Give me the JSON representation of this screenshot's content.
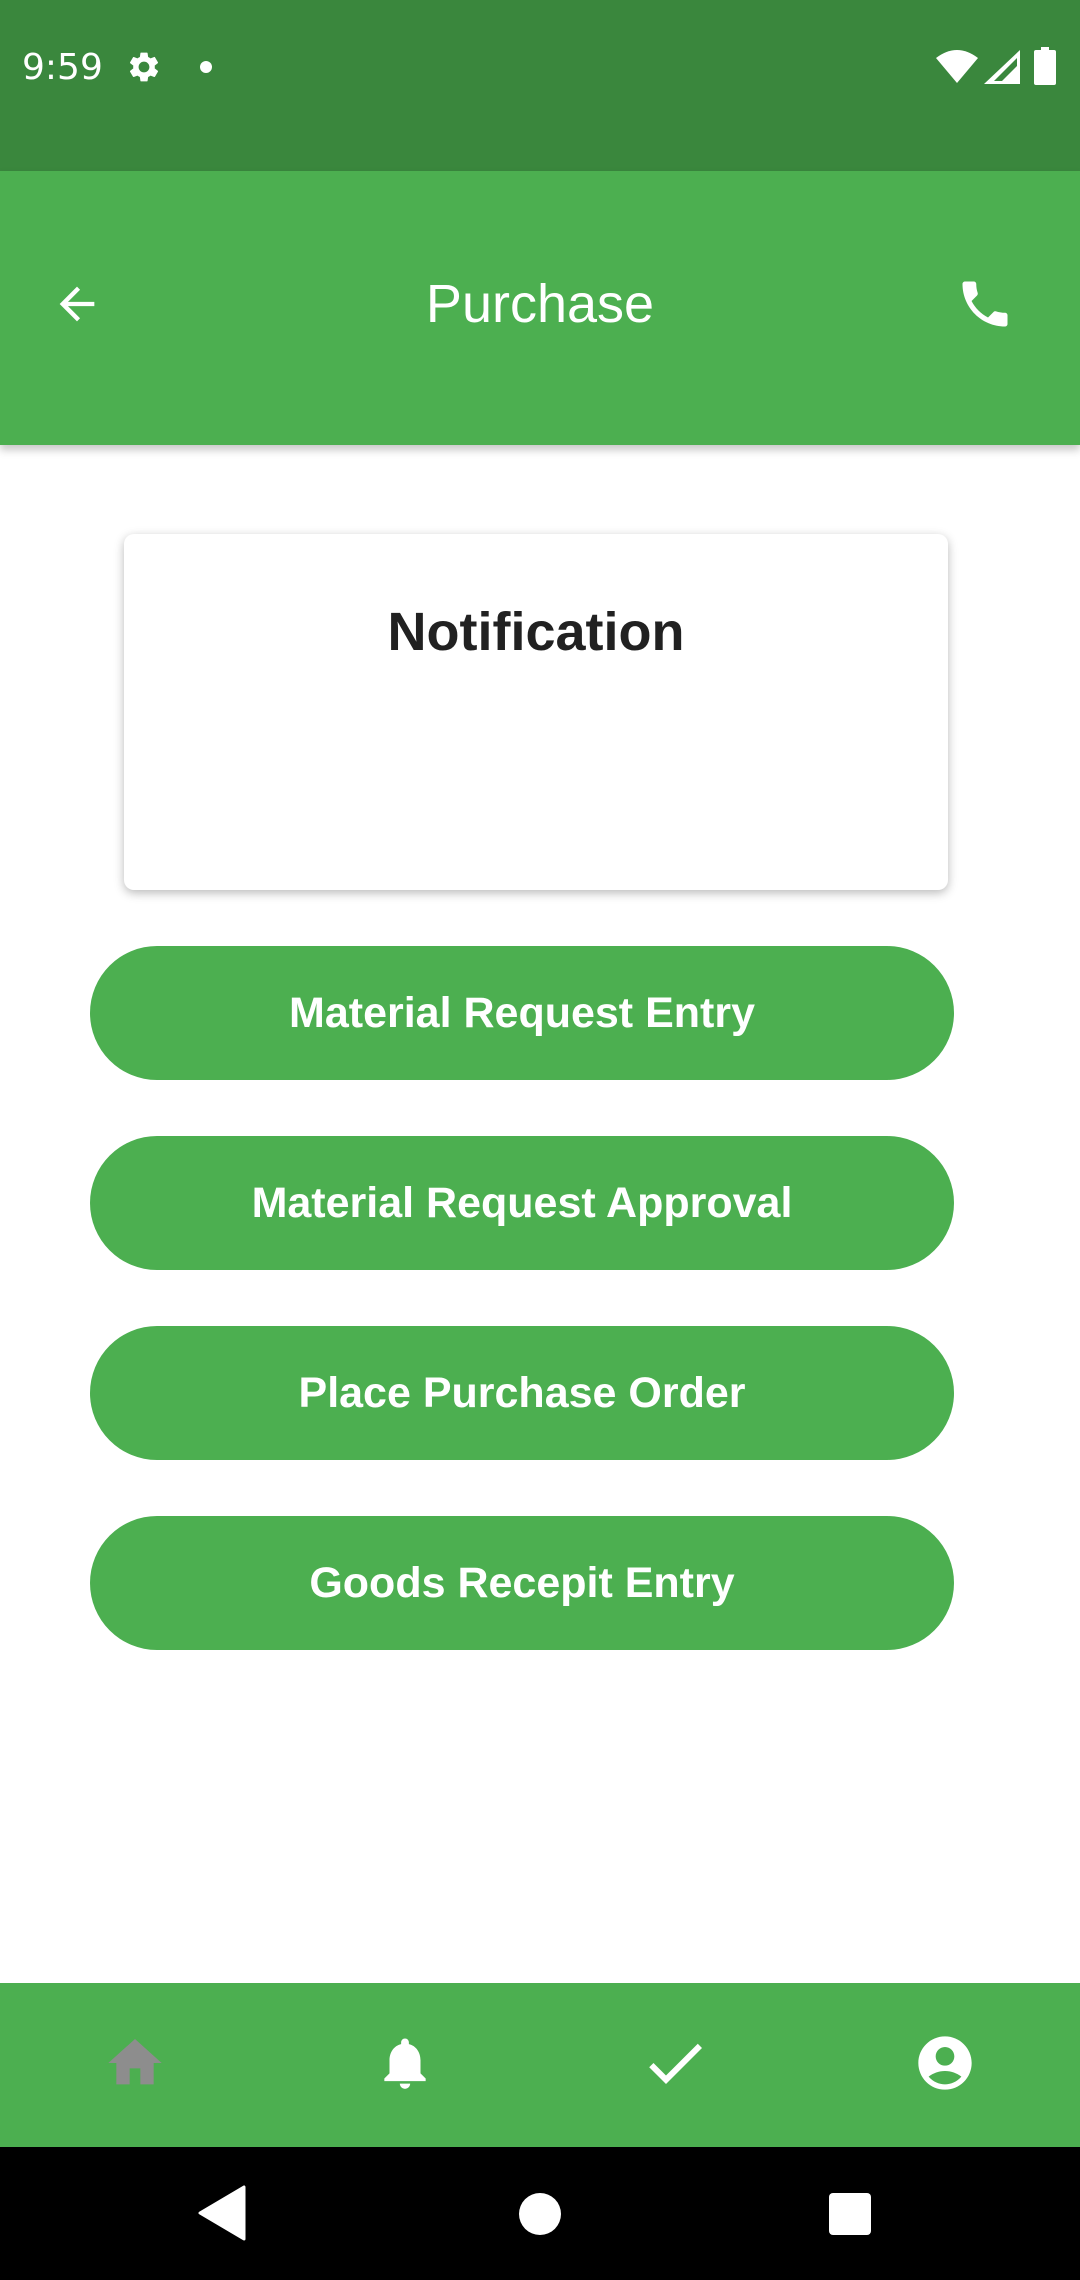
{
  "status_bar": {
    "time": "9:59",
    "icons": [
      "gear-icon",
      "dot-icon",
      "wifi-icon",
      "signal-icon",
      "battery-icon"
    ]
  },
  "app_bar": {
    "title": "Purchase",
    "back_icon": "arrow-back-icon",
    "action_icon": "phone-icon"
  },
  "notification_card": {
    "title": "Notification"
  },
  "actions": [
    {
      "label": "Material Request Entry"
    },
    {
      "label": "Material Request Approval"
    },
    {
      "label": "Place Purchase Order"
    },
    {
      "label": "Goods Recepit Entry"
    }
  ],
  "bottom_nav": {
    "items": [
      {
        "icon": "home-icon",
        "selected": true
      },
      {
        "icon": "bell-icon",
        "selected": false
      },
      {
        "icon": "check-icon",
        "selected": false
      },
      {
        "icon": "account-icon",
        "selected": false
      }
    ]
  },
  "colors": {
    "status_bar": "#3a873d",
    "primary": "#4caf50",
    "on_primary": "#ffffff",
    "selected_nav_icon": "#8d8d8d",
    "card_title": "#212121"
  }
}
